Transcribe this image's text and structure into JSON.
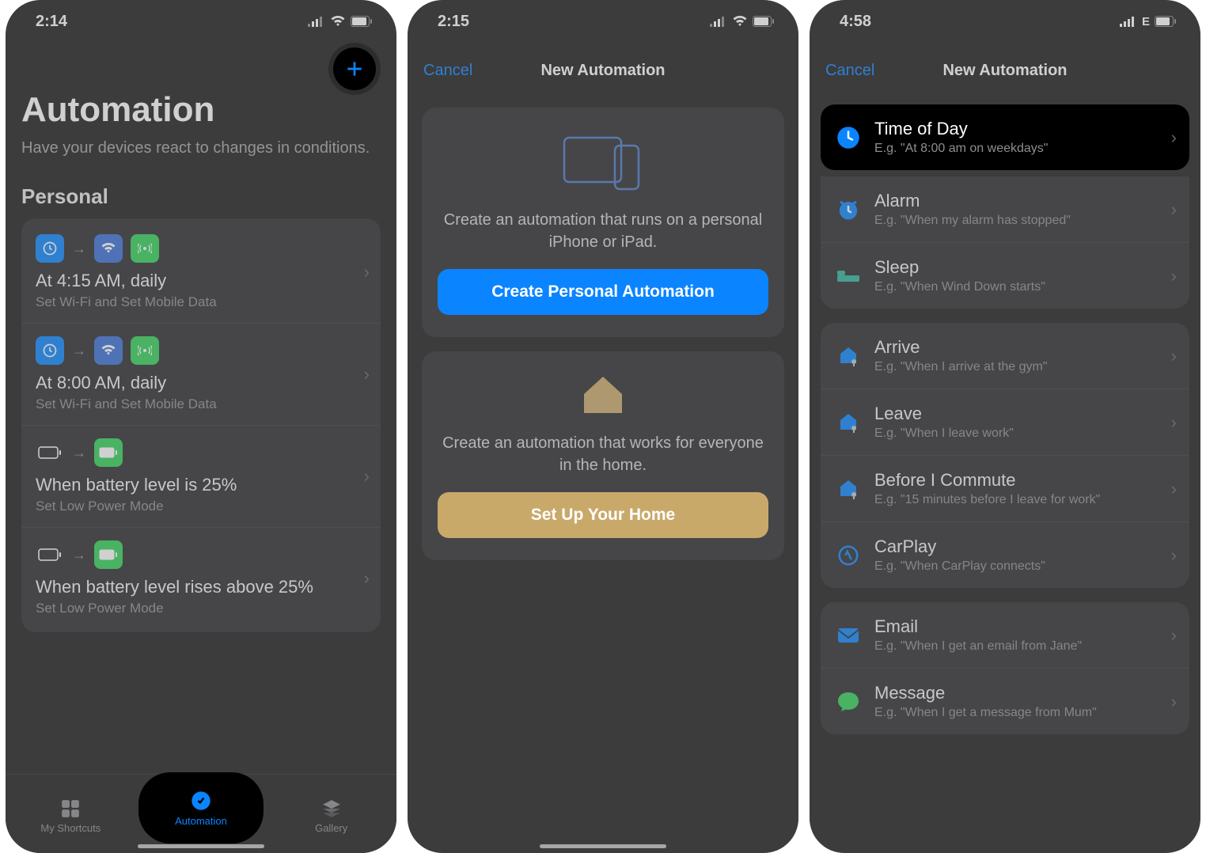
{
  "screen1": {
    "time": "2:14",
    "title": "Automation",
    "subtitle": "Have your devices react to changes in conditions.",
    "section": "Personal",
    "rows": [
      {
        "title": "At 4:15 AM, daily",
        "sub": "Set Wi-Fi and Set Mobile Data"
      },
      {
        "title": "At 8:00 AM, daily",
        "sub": "Set Wi-Fi and Set Mobile Data"
      },
      {
        "title": "When battery level is 25%",
        "sub": "Set Low Power Mode"
      },
      {
        "title": "When battery level rises above 25%",
        "sub": "Set Low Power Mode"
      }
    ],
    "tabs": {
      "shortcuts": "My Shortcuts",
      "automation": "Automation",
      "gallery": "Gallery"
    }
  },
  "screen2": {
    "time": "2:15",
    "cancel": "Cancel",
    "navtitle": "New Automation",
    "personal": {
      "text": "Create an automation that runs on a personal iPhone or iPad.",
      "button": "Create Personal Automation"
    },
    "home": {
      "text": "Create an automation that works for everyone in the home.",
      "button": "Set Up Your Home"
    }
  },
  "screen3": {
    "time": "4:58",
    "network": "E",
    "cancel": "Cancel",
    "navtitle": "New Automation",
    "group1": [
      {
        "t": "Time of Day",
        "s": "E.g. \"At 8:00 am on weekdays\""
      }
    ],
    "group1b": [
      {
        "t": "Alarm",
        "s": "E.g. \"When my alarm has stopped\""
      },
      {
        "t": "Sleep",
        "s": "E.g. \"When Wind Down starts\""
      }
    ],
    "group2": [
      {
        "t": "Arrive",
        "s": "E.g. \"When I arrive at the gym\""
      },
      {
        "t": "Leave",
        "s": "E.g. \"When I leave work\""
      },
      {
        "t": "Before I Commute",
        "s": "E.g. \"15 minutes before I leave for work\""
      },
      {
        "t": "CarPlay",
        "s": "E.g. \"When CarPlay connects\""
      }
    ],
    "group3": [
      {
        "t": "Email",
        "s": "E.g. \"When I get an email from Jane\""
      },
      {
        "t": "Message",
        "s": "E.g. \"When I get a message from Mum\""
      }
    ]
  }
}
